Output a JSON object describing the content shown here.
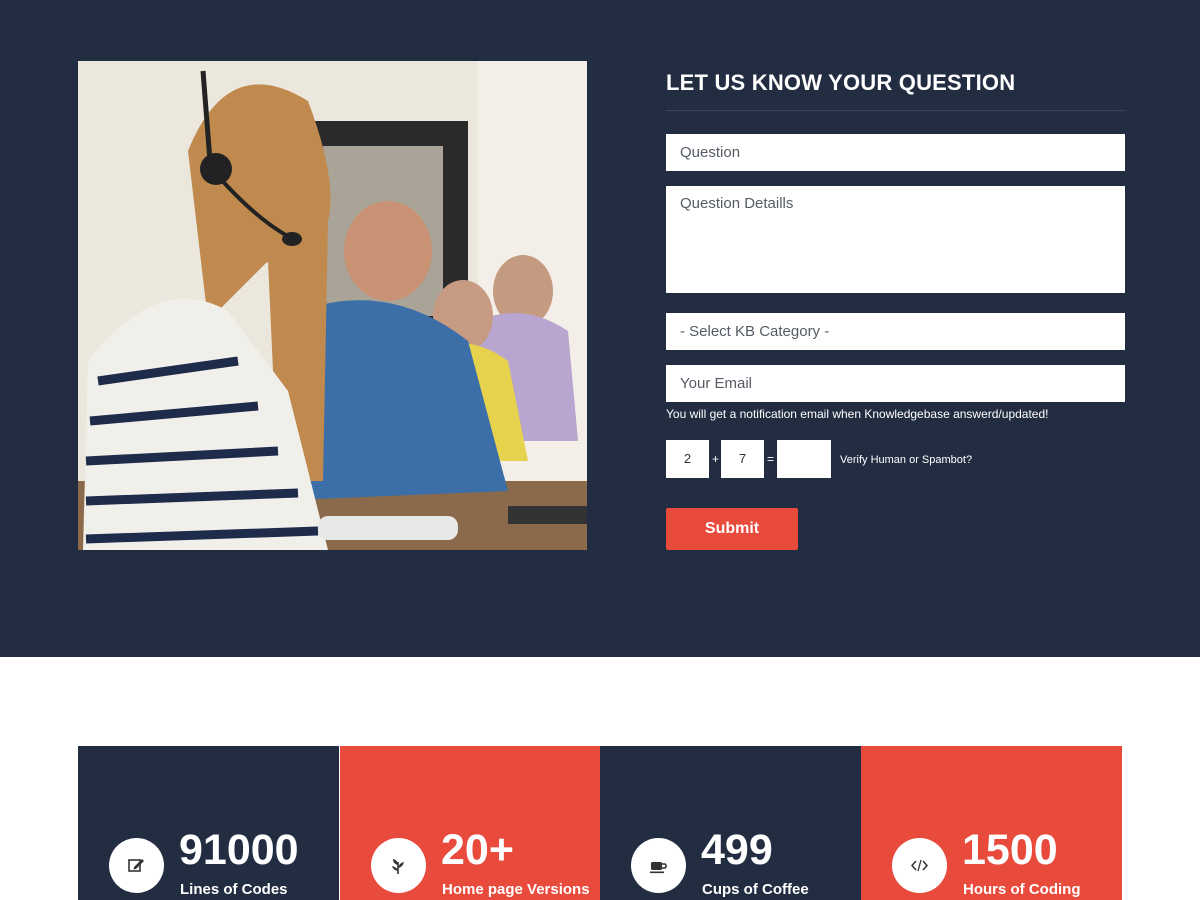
{
  "form": {
    "title": "LET US KNOW YOUR QUESTION",
    "question_placeholder": "Question",
    "details_placeholder": "Question Detaills",
    "category_selected": "-  Select KB Category  -",
    "email_placeholder": "Your Email",
    "notice": "You will get a notification email when Knowledgebase answerd/updated!",
    "captcha": {
      "a": "2",
      "op": "+",
      "b": "7",
      "eq": "=",
      "answer": "",
      "label": "Verify Human or Spambot?"
    },
    "submit_label": "Submit"
  },
  "stats": [
    {
      "value": "91000",
      "label": "Lines of Codes",
      "icon": "edit-icon",
      "color": "#222d42"
    },
    {
      "value": "20+",
      "label": "Home page Versions",
      "icon": "leaf-icon",
      "color": "#e84a3c"
    },
    {
      "value": "499",
      "label": "Cups of Coffee",
      "icon": "coffee-cup-icon",
      "color": "#222d42"
    },
    {
      "value": "1500",
      "label": "Hours of Coding",
      "icon": "code-icon",
      "color": "#e84a3c"
    }
  ],
  "colors": {
    "navy": "#222d42",
    "accent": "#e84a3c",
    "white": "#ffffff"
  }
}
